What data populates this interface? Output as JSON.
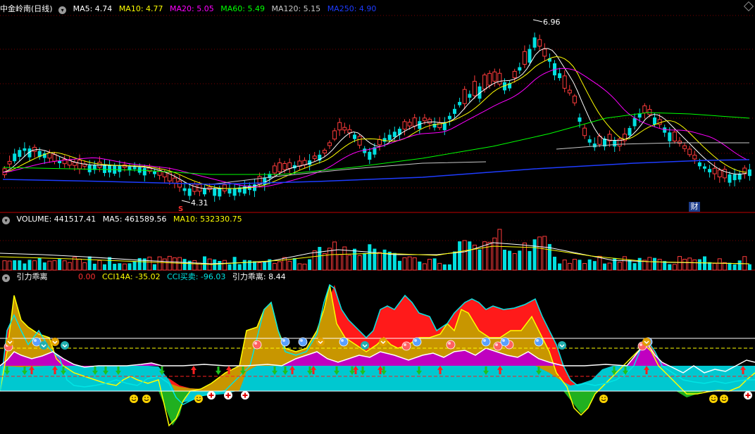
{
  "main_panel": {
    "title": "中金岭南(日线)",
    "indicators": [
      {
        "label": "MA5: 4.74",
        "color": "#ffffff"
      },
      {
        "label": "MA10: 4.77",
        "color": "#ffff00"
      },
      {
        "label": "MA20: 5.05",
        "color": "#ff00ff"
      },
      {
        "label": "MA60: 5.49",
        "color": "#00ff00"
      },
      {
        "label": "MA120: 5.15",
        "color": "#c8c8c8"
      },
      {
        "label": "MA250: 4.90",
        "color": "#1e3cff"
      }
    ],
    "high_label": "6.96",
    "low_label": "4.31",
    "s_marker": "S",
    "event_marker": "财"
  },
  "volume_panel": {
    "indicators": [
      {
        "label": "VOLUME: 441517.41",
        "color": "#ffffff"
      },
      {
        "label": "MA5: 461589.56",
        "color": "#ffffff"
      },
      {
        "label": "MA10: 532330.75",
        "color": "#ffff00"
      }
    ]
  },
  "cci_panel": {
    "title": "引力乖离",
    "indicators": [
      {
        "label": "0.00",
        "color": "#ff3030"
      },
      {
        "label": "CCI14A: -35.02",
        "color": "#ffff00"
      },
      {
        "label": "CCI买卖: -96.03",
        "color": "#00e5e5"
      },
      {
        "label": "引力乖离: 8.44",
        "color": "#ffffff"
      }
    ]
  },
  "colors": {
    "up": "#ff3b3b",
    "down": "#00e0e0",
    "grid": "#8b0000"
  }
}
